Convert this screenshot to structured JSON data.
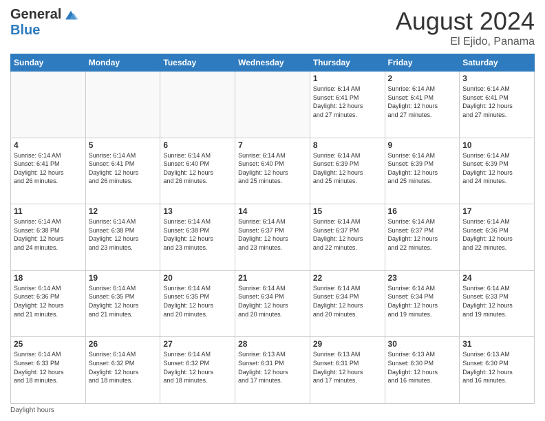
{
  "logo": {
    "general": "General",
    "blue": "Blue"
  },
  "title": "August 2024",
  "location": "El Ejido, Panama",
  "days_header": [
    "Sunday",
    "Monday",
    "Tuesday",
    "Wednesday",
    "Thursday",
    "Friday",
    "Saturday"
  ],
  "weeks": [
    [
      {
        "day": "",
        "info": ""
      },
      {
        "day": "",
        "info": ""
      },
      {
        "day": "",
        "info": ""
      },
      {
        "day": "",
        "info": ""
      },
      {
        "day": "1",
        "info": "Sunrise: 6:14 AM\nSunset: 6:41 PM\nDaylight: 12 hours\nand 27 minutes."
      },
      {
        "day": "2",
        "info": "Sunrise: 6:14 AM\nSunset: 6:41 PM\nDaylight: 12 hours\nand 27 minutes."
      },
      {
        "day": "3",
        "info": "Sunrise: 6:14 AM\nSunset: 6:41 PM\nDaylight: 12 hours\nand 27 minutes."
      }
    ],
    [
      {
        "day": "4",
        "info": "Sunrise: 6:14 AM\nSunset: 6:41 PM\nDaylight: 12 hours\nand 26 minutes."
      },
      {
        "day": "5",
        "info": "Sunrise: 6:14 AM\nSunset: 6:41 PM\nDaylight: 12 hours\nand 26 minutes."
      },
      {
        "day": "6",
        "info": "Sunrise: 6:14 AM\nSunset: 6:40 PM\nDaylight: 12 hours\nand 26 minutes."
      },
      {
        "day": "7",
        "info": "Sunrise: 6:14 AM\nSunset: 6:40 PM\nDaylight: 12 hours\nand 25 minutes."
      },
      {
        "day": "8",
        "info": "Sunrise: 6:14 AM\nSunset: 6:39 PM\nDaylight: 12 hours\nand 25 minutes."
      },
      {
        "day": "9",
        "info": "Sunrise: 6:14 AM\nSunset: 6:39 PM\nDaylight: 12 hours\nand 25 minutes."
      },
      {
        "day": "10",
        "info": "Sunrise: 6:14 AM\nSunset: 6:39 PM\nDaylight: 12 hours\nand 24 minutes."
      }
    ],
    [
      {
        "day": "11",
        "info": "Sunrise: 6:14 AM\nSunset: 6:38 PM\nDaylight: 12 hours\nand 24 minutes."
      },
      {
        "day": "12",
        "info": "Sunrise: 6:14 AM\nSunset: 6:38 PM\nDaylight: 12 hours\nand 23 minutes."
      },
      {
        "day": "13",
        "info": "Sunrise: 6:14 AM\nSunset: 6:38 PM\nDaylight: 12 hours\nand 23 minutes."
      },
      {
        "day": "14",
        "info": "Sunrise: 6:14 AM\nSunset: 6:37 PM\nDaylight: 12 hours\nand 23 minutes."
      },
      {
        "day": "15",
        "info": "Sunrise: 6:14 AM\nSunset: 6:37 PM\nDaylight: 12 hours\nand 22 minutes."
      },
      {
        "day": "16",
        "info": "Sunrise: 6:14 AM\nSunset: 6:37 PM\nDaylight: 12 hours\nand 22 minutes."
      },
      {
        "day": "17",
        "info": "Sunrise: 6:14 AM\nSunset: 6:36 PM\nDaylight: 12 hours\nand 22 minutes."
      }
    ],
    [
      {
        "day": "18",
        "info": "Sunrise: 6:14 AM\nSunset: 6:36 PM\nDaylight: 12 hours\nand 21 minutes."
      },
      {
        "day": "19",
        "info": "Sunrise: 6:14 AM\nSunset: 6:35 PM\nDaylight: 12 hours\nand 21 minutes."
      },
      {
        "day": "20",
        "info": "Sunrise: 6:14 AM\nSunset: 6:35 PM\nDaylight: 12 hours\nand 20 minutes."
      },
      {
        "day": "21",
        "info": "Sunrise: 6:14 AM\nSunset: 6:34 PM\nDaylight: 12 hours\nand 20 minutes."
      },
      {
        "day": "22",
        "info": "Sunrise: 6:14 AM\nSunset: 6:34 PM\nDaylight: 12 hours\nand 20 minutes."
      },
      {
        "day": "23",
        "info": "Sunrise: 6:14 AM\nSunset: 6:34 PM\nDaylight: 12 hours\nand 19 minutes."
      },
      {
        "day": "24",
        "info": "Sunrise: 6:14 AM\nSunset: 6:33 PM\nDaylight: 12 hours\nand 19 minutes."
      }
    ],
    [
      {
        "day": "25",
        "info": "Sunrise: 6:14 AM\nSunset: 6:33 PM\nDaylight: 12 hours\nand 18 minutes."
      },
      {
        "day": "26",
        "info": "Sunrise: 6:14 AM\nSunset: 6:32 PM\nDaylight: 12 hours\nand 18 minutes."
      },
      {
        "day": "27",
        "info": "Sunrise: 6:14 AM\nSunset: 6:32 PM\nDaylight: 12 hours\nand 18 minutes."
      },
      {
        "day": "28",
        "info": "Sunrise: 6:13 AM\nSunset: 6:31 PM\nDaylight: 12 hours\nand 17 minutes."
      },
      {
        "day": "29",
        "info": "Sunrise: 6:13 AM\nSunset: 6:31 PM\nDaylight: 12 hours\nand 17 minutes."
      },
      {
        "day": "30",
        "info": "Sunrise: 6:13 AM\nSunset: 6:30 PM\nDaylight: 12 hours\nand 16 minutes."
      },
      {
        "day": "31",
        "info": "Sunrise: 6:13 AM\nSunset: 6:30 PM\nDaylight: 12 hours\nand 16 minutes."
      }
    ]
  ],
  "footer": "Daylight hours"
}
